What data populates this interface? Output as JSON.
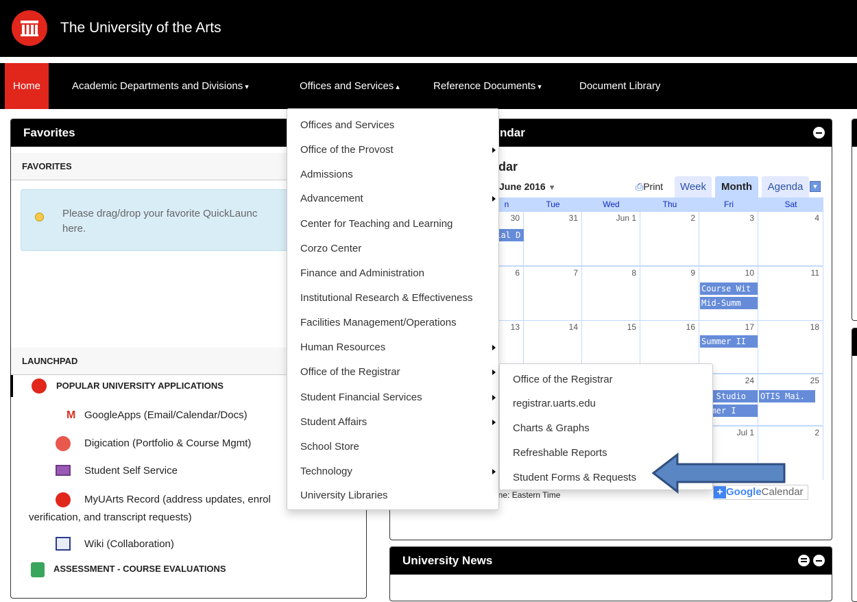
{
  "header": {
    "site_title": "The University of the Arts",
    "logo_icon": "university-columns-icon",
    "brand_color": "#e1261c"
  },
  "nav": {
    "home": "Home",
    "academic": "Academic Departments and Divisions",
    "offices": "Offices and Services",
    "reference": "Reference Documents",
    "library": "Document Library",
    "caret_down": "▾",
    "caret_up": "▴"
  },
  "favorites": {
    "title": "Favorites",
    "subhead": "FAVORITES",
    "hint_line1": "Please drag/drop your favorite QuickLaunc",
    "hint_line2": "here."
  },
  "launchpad": {
    "title": "LAUNCHPAD",
    "section": "POPULAR UNIVERSITY APPLICATIONS",
    "apps": [
      {
        "label": "GoogleApps (Email/Calendar/Docs)",
        "icon": "gmail-icon"
      },
      {
        "label": "Digication (Portfolio & Course Mgmt)",
        "icon": "digication-icon"
      },
      {
        "label": "Student Self Service",
        "icon": "monitor-icon"
      },
      {
        "label": "MyUArts Record (address updates, enrol",
        "label2": "verification, and transcript requests)",
        "icon": "uarts-icon"
      },
      {
        "label": "Wiki (Collaboration)",
        "icon": "wiki-icon"
      }
    ],
    "section2": "ASSESSMENT - COURSE EVALUATIONS"
  },
  "calendar": {
    "panel_title": "ndar",
    "heading": "ndar",
    "month_label": "June 2016",
    "print": "Print",
    "tabs": [
      "Week",
      "Month",
      "Agenda"
    ],
    "days": [
      "n",
      "Tue",
      "Wed",
      "Thu",
      "Fri",
      "Sat"
    ],
    "weeks": [
      [
        "30",
        "31",
        "Jun 1",
        "2",
        "3",
        "4"
      ],
      [
        "6",
        "7",
        "8",
        "9",
        "10",
        "11"
      ],
      [
        "13",
        "14",
        "15",
        "16",
        "17",
        "18"
      ],
      [
        "",
        "",
        "",
        "",
        "24",
        "25"
      ],
      [
        "",
        "",
        "",
        "",
        "Jul 1",
        "2"
      ]
    ],
    "events": {
      "memorial": "rial D",
      "course_wit": "Course Wit",
      "mid_summ": "Mid-Summ",
      "summer_ii": "Summer II",
      "fa_studio": "FA Studio",
      "otis": "OTIS Mai.",
      "summer_i": "ummer I"
    },
    "timezone": "zone: Eastern Time",
    "google_plus": "+",
    "google": "Google",
    "google_cal": "Calendar"
  },
  "news": {
    "title": "University News"
  },
  "offices_menu": [
    "Offices and Services",
    "Office of the Provost",
    "Admissions",
    "Advancement",
    "Center for Teaching and Learning",
    "Corzo Center",
    "Finance and Administration",
    "Institutional Research & Effectiveness",
    "Facilities Management/Operations",
    "Human Resources",
    "Office of the Registrar",
    "Student Financial Services",
    "Student Affairs",
    "School Store",
    "Technology",
    "University Libraries"
  ],
  "registrar_menu": [
    "Office of the Registrar",
    "registrar.uarts.edu",
    "Charts & Graphs",
    "Refreshable Reports",
    "Student Forms & Requests"
  ],
  "annotation": {
    "arrow_color": "#5b86c4",
    "arrow_icon": "left-arrow-annotation"
  }
}
